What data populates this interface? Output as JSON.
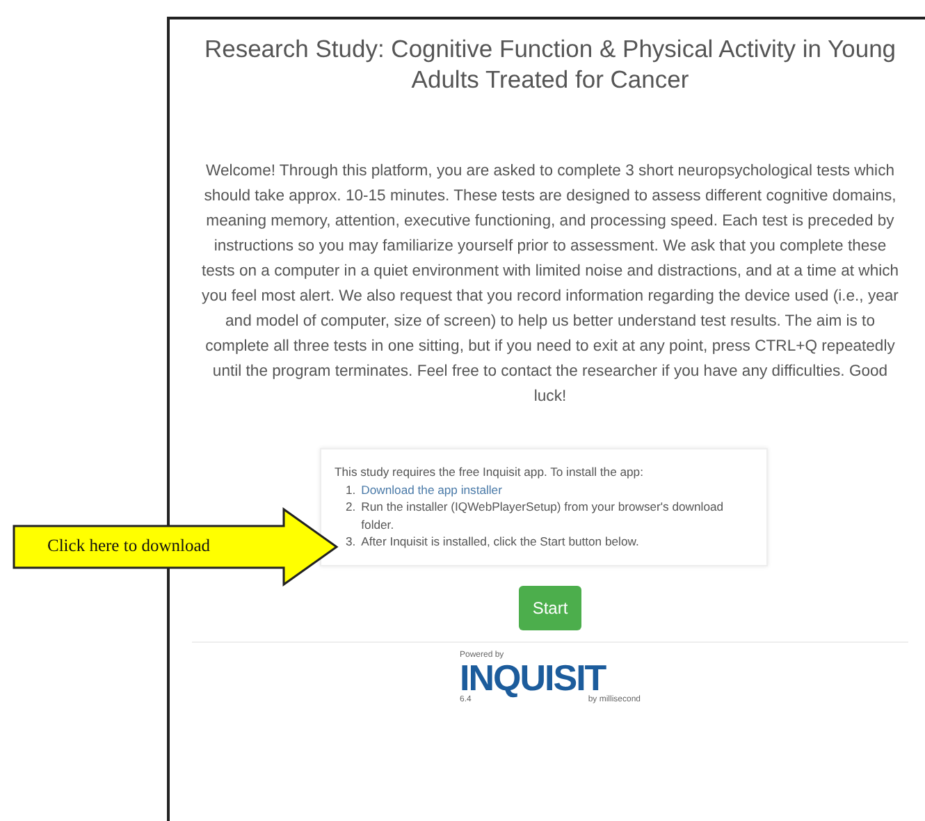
{
  "title": "Research Study: Cognitive Function & Physical Activity in Young Adults Treated for Cancer",
  "intro": "Welcome! Through this platform, you are asked to complete 3 short neuropsychological tests which should take approx. 10-15 minutes. These tests are designed to assess different cognitive domains, meaning memory, attention, executive functioning, and processing speed. Each test is preceded by instructions so you may familiarize yourself prior to assessment. We ask that you complete these tests on a computer in a quiet environment with limited noise and distractions, and at a time at which you feel most alert. We also request that you record information regarding the device used (i.e., year and model of computer, size of screen) to help us better understand test results. The aim is to complete all three tests in one sitting, but if you need to exit at any point, press CTRL+Q repeatedly until the program terminates. Feel free to contact the researcher if you have any difficulties. Good luck!",
  "install_box": {
    "lead": "This study requires the free Inquisit app. To install the app:",
    "steps": [
      {
        "number": "1.",
        "text": "Download the app installer",
        "kind": "link"
      },
      {
        "number": "2.",
        "text": "Run the installer (IQWebPlayerSetup) from your browser's download folder.",
        "kind": "text"
      },
      {
        "number": "3.",
        "text": "After Inquisit is installed, click the Start button below.",
        "kind": "text"
      }
    ]
  },
  "callout": "Click here to download",
  "start_button": "Start",
  "logo": {
    "caption": "Powered by",
    "name": "INQUISIT",
    "version": "6.4",
    "maker": "by millisecond"
  }
}
